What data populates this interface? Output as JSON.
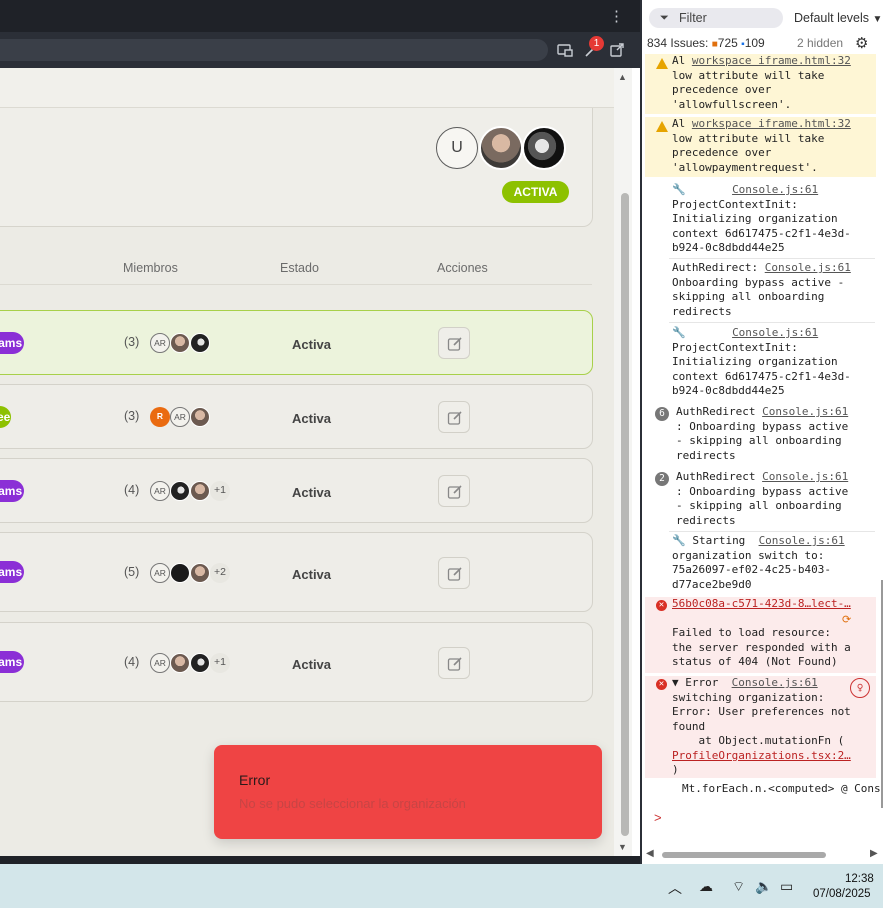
{
  "page": {
    "avatar_initial": "U",
    "org_status": "ACTIVA",
    "columns": {
      "members": "Miembros",
      "status": "Estado",
      "actions": "Acciones"
    },
    "rows": [
      {
        "plan": "Teams",
        "count": "(3)",
        "avatars": [
          "AR",
          "photo",
          "photo"
        ],
        "extra": "",
        "status": "Activa",
        "selected": true
      },
      {
        "plan": "Free",
        "count": "(3)",
        "avatars": [
          "R",
          "AR",
          "photo"
        ],
        "extra": "",
        "status": "Activa",
        "selected": false
      },
      {
        "plan": "Teams",
        "count": "(4)",
        "avatars": [
          "AR",
          "photo",
          "photo"
        ],
        "extra": "+1",
        "status": "Activa",
        "selected": false
      },
      {
        "plan": "Teams",
        "count": "(5)",
        "avatars": [
          "AR",
          "dark",
          "photo"
        ],
        "extra": "+2",
        "status": "Activa",
        "selected": false
      },
      {
        "plan": "Teams",
        "count": "(4)",
        "avatars": [
          "AR",
          "photo",
          "photo"
        ],
        "extra": "+1",
        "status": "Activa",
        "selected": false
      }
    ]
  },
  "toast": {
    "title": "Error",
    "message": "No se pudo seleccionar la organización"
  },
  "browser": {
    "notification_count": "1"
  },
  "devtools": {
    "filter_placeholder": "Filter",
    "levels": "Default levels",
    "issues": {
      "total": "834 Issues:",
      "warnings": "725",
      "info": "109",
      "hidden": "2 hidden"
    },
    "logs": [
      {
        "type": "warn",
        "prefix": "Al",
        "link": "workspace iframe.html:32",
        "text": "low attribute will take\nprecedence over\n'allowfullscreen'."
      },
      {
        "type": "warn",
        "prefix": "Al",
        "link": "workspace iframe.html:32",
        "text": "low attribute will take\nprecedence over\n'allowpaymentrequest'."
      },
      {
        "type": "info",
        "link": "Console.js:61",
        "text": "ProjectContextInit:\nInitializing organization\ncontext 6d617475-c2f1-4e3d-\nb924-0c8dbdd44e25"
      },
      {
        "type": "info",
        "prefix": "AuthRedirect:",
        "link": "Console.js:61",
        "text": "Onboarding bypass active -\nskipping all onboarding\nredirects"
      },
      {
        "type": "info",
        "link": "Console.js:61",
        "text": "ProjectContextInit:\nInitializing organization\ncontext 6d617475-c2f1-4e3d-\nb924-0c8dbdd44e25"
      },
      {
        "type": "count",
        "count": "6",
        "prefix": "AuthRedirect",
        "link": "Console.js:61",
        "text": ": Onboarding bypass active\n- skipping all onboarding\nredirects"
      },
      {
        "type": "count",
        "count": "2",
        "prefix": "AuthRedirect",
        "link": "Console.js:61",
        "text": ": Onboarding bypass active\n- skipping all onboarding\nredirects"
      },
      {
        "type": "info",
        "prefix": "Starting",
        "link": "Console.js:61",
        "text": "organization switch to:\n75a26097-ef02-4c25-b403-\nd77ace2be9d0"
      },
      {
        "type": "error",
        "link": "56b0c08a-c571-423d-8…lect-…",
        "text": "Failed to load resource:\nthe server responded with a\nstatus of 404 (Not Found)"
      },
      {
        "type": "error",
        "prefix": "▼ Error",
        "link": "Console.js:61",
        "text": "switching organization:\nError: User preferences not\nfound\n    at Object.mutationFn (",
        "link2": "ProfileOrganizations.tsx:2…",
        "tail": ")"
      }
    ],
    "trace": "Mt.forEach.n.<computed> @ Conso",
    "prompt": ">"
  },
  "taskbar": {
    "time": "12:38",
    "date": "07/08/2025"
  }
}
